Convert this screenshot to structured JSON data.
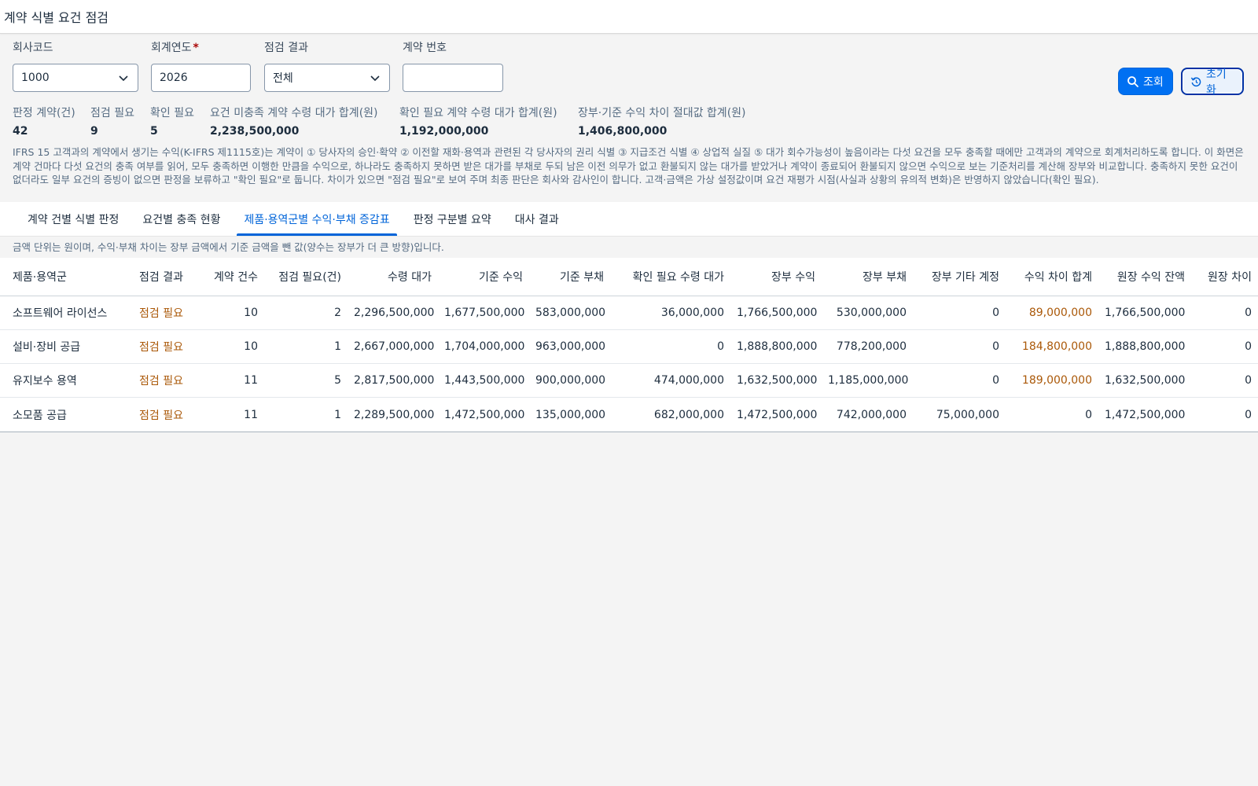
{
  "page": {
    "title": "계약 식별 요건 점검"
  },
  "filters": {
    "company_code": {
      "label": "회사코드",
      "value": "1000"
    },
    "fiscal_year": {
      "label": "회계연도",
      "required_mark": "*",
      "value": "2026"
    },
    "check_result": {
      "label": "점검 결과",
      "value": "전체"
    },
    "contract_no": {
      "label": "계약 번호",
      "value": ""
    }
  },
  "buttons": {
    "search": "조회",
    "reset": "초기화"
  },
  "kpis": [
    {
      "label": "판정 계약(건)",
      "value": "42"
    },
    {
      "label": "점검 필요",
      "value": "9"
    },
    {
      "label": "확인 필요",
      "value": "5"
    },
    {
      "label": "요건 미충족 계약 수령 대가 합계(원)",
      "value": "2,238,500,000"
    },
    {
      "label": "확인 필요 계약 수령 대가 합계(원)",
      "value": "1,192,000,000"
    },
    {
      "label": "장부·기준 수익 차이 절대값 합계(원)",
      "value": "1,406,800,000"
    }
  ],
  "description": "IFRS 15 고객과의 계약에서 생기는 수익(K-IFRS 제1115호)는 계약이 ① 당사자의 승인·확약 ② 이전할 재화·용역과 관련된 각 당사자의 권리 식별 ③ 지급조건 식별 ④ 상업적 실질 ⑤ 대가 회수가능성이 높음이라는 다섯 요건을 모두 충족할 때에만 고객과의 계약으로 회계처리하도록 합니다. 이 화면은 계약 건마다 다섯 요건의 충족 여부를 읽어, 모두 충족하면 이행한 만큼을 수익으로, 하나라도 충족하지 못하면 받은 대가를 부채로 두되 남은 이전 의무가 없고 환불되지 않는 대가를 받았거나 계약이 종료되어 환불되지 않으면 수익으로 보는 기준처리를 계산해 장부와 비교합니다. 충족하지 못한 요건이 없더라도 일부 요건의 증빙이 없으면 판정을 보류하고 \"확인 필요\"로 둡니다. 차이가 있으면 \"점검 필요\"로 보여 주며 최종 판단은 회사와 감사인이 합니다. 고객·금액은 가상 설정값이며 요건 재평가 시점(사실과 상황의 유의적 변화)은 반영하지 않았습니다(확인 필요).",
  "tabs": [
    {
      "label": "계약 건별 식별 판정",
      "active": false
    },
    {
      "label": "요건별 충족 현황",
      "active": false
    },
    {
      "label": "제품·용역군별 수익·부채 증감표",
      "active": true
    },
    {
      "label": "판정 구분별 요약",
      "active": false
    },
    {
      "label": "대사 결과",
      "active": false
    }
  ],
  "table_note": "금액 단위는 원이며, 수익·부채 차이는 장부 금액에서 기준 금액을 뺀 값(양수는 장부가 더 큰 방향)입니다.",
  "table": {
    "columns": [
      "제품·용역군",
      "점검 결과",
      "계약 건수",
      "점검 필요(건)",
      "수령 대가",
      "기준 수익",
      "기준 부채",
      "확인 필요 수령 대가",
      "장부 수익",
      "장부 부채",
      "장부 기타 계정",
      "수익 차이 합계",
      "원장 수익 잔액",
      "원장 차이"
    ],
    "rows": [
      [
        "소프트웨어 라이선스",
        "점검 필요",
        "10",
        "2",
        "2,296,500,000",
        "1,677,500,000",
        "583,000,000",
        "36,000,000",
        "1,766,500,000",
        "530,000,000",
        "0",
        "89,000,000",
        "1,766,500,000",
        "0"
      ],
      [
        "설비·장비 공급",
        "점검 필요",
        "10",
        "1",
        "2,667,000,000",
        "1,704,000,000",
        "963,000,000",
        "0",
        "1,888,800,000",
        "778,200,000",
        "0",
        "184,800,000",
        "1,888,800,000",
        "0"
      ],
      [
        "유지보수 용역",
        "점검 필요",
        "11",
        "5",
        "2,817,500,000",
        "1,443,500,000",
        "900,000,000",
        "474,000,000",
        "1,632,500,000",
        "1,185,000,000",
        "0",
        "189,000,000",
        "1,632,500,000",
        "0"
      ],
      [
        "소모품 공급",
        "점검 필요",
        "11",
        "1",
        "2,289,500,000",
        "1,472,500,000",
        "135,000,000",
        "682,000,000",
        "1,472,500,000",
        "742,000,000",
        "75,000,000",
        "0",
        "1,472,500,000",
        "0"
      ]
    ]
  },
  "colors": {
    "accent": "#0064d9",
    "warning": "#aa5808",
    "required": "#aa0808"
  },
  "icons": {
    "search": "search-icon",
    "reset": "reset-icon",
    "dropdown": "chevron-down-icon"
  }
}
